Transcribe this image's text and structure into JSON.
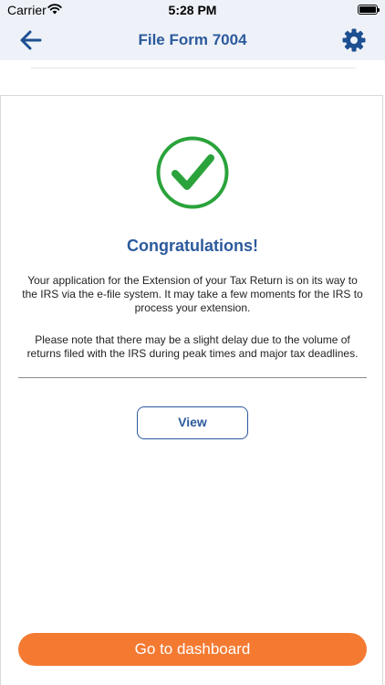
{
  "status_bar": {
    "carrier": "Carrier",
    "time": "5:28 PM"
  },
  "nav": {
    "title": "File Form 7004",
    "back_icon": "arrow-left-icon",
    "settings_icon": "gear-icon"
  },
  "success": {
    "icon": "check-circle-icon",
    "title": "Congratulations!",
    "message": "Your application for the Extension of your Tax Return is on its way to the IRS via the e-file system. It may take a few moments for the IRS to process your extension.",
    "note": "Please note that there may be a slight delay due to the volume of returns filed with the IRS during peak times and major tax deadlines."
  },
  "actions": {
    "view_label": "View",
    "dashboard_label": "Go to dashboard"
  },
  "colors": {
    "primary": "#2c5a9c",
    "success": "#2aa33b",
    "accent": "#f47a32",
    "header_bg": "#eef2f8"
  }
}
